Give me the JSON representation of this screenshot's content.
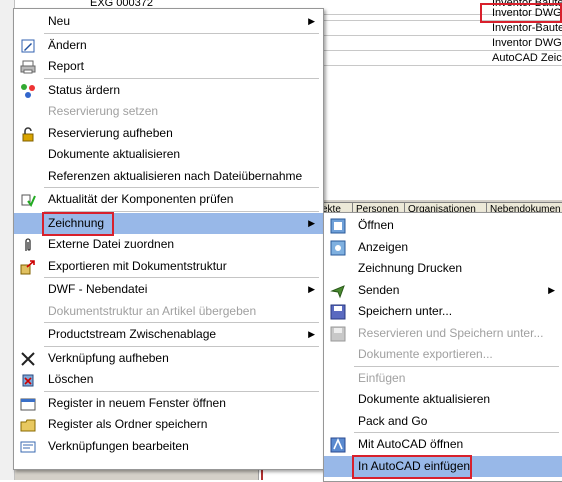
{
  "background": {
    "top_rows": [
      {
        "left": "EXG 000372",
        "right": "Inventor Bautei"
      },
      {
        "left": "",
        "right": "Inventor DWG"
      },
      {
        "left": "",
        "right": "Inventor-Bauteil"
      },
      {
        "left": "",
        "right": "Inventor DWG"
      },
      {
        "left": "",
        "right": "AutoCAD Zeich"
      }
    ],
    "tabs": [
      "ekte",
      "Personen",
      "Organisationen",
      "Nebendokumen"
    ]
  },
  "context_menu": {
    "items": [
      {
        "label": "Neu",
        "icon": "blank",
        "submenu": true
      },
      {
        "label": "Ändern",
        "icon": "edit-pencil-icon"
      },
      {
        "label": "Report",
        "icon": "printer-icon"
      },
      {
        "label": "Status ärdern",
        "icon": "status-icon"
      },
      {
        "label": "Reservierung setzen",
        "icon": "blank",
        "disabled": true
      },
      {
        "label": "Reservierung aufheben",
        "icon": "unlock-icon"
      },
      {
        "label": "Dokumente aktualisieren",
        "icon": "blank"
      },
      {
        "label": "Referenzen aktualisieren nach Dateiübernahme",
        "icon": "blank"
      },
      {
        "label": "Aktualität der Komponenten prüfen",
        "icon": "component-check-icon"
      },
      {
        "label": "Zeichnung",
        "icon": "blank",
        "submenu": true,
        "highlighted": true
      },
      {
        "label": "Externe Datei zuordnen",
        "icon": "paperclip-icon"
      },
      {
        "label": "Exportieren mit Dokumentstruktur",
        "icon": "export-icon"
      },
      {
        "label": "DWF - Nebendatei",
        "icon": "blank",
        "submenu": true
      },
      {
        "label": "Dokumentstruktur an Artikel übergeben",
        "icon": "blank",
        "disabled": true
      },
      {
        "label": "Productstream Zwischenablage",
        "icon": "blank",
        "submenu": true
      },
      {
        "label": "Verknüpfung aufheben",
        "icon": "unlink-icon"
      },
      {
        "label": "Löschen",
        "icon": "delete-icon"
      },
      {
        "label": "Register in neuem Fenster öffnen",
        "icon": "new-window-icon"
      },
      {
        "label": "Register als Ordner speichern",
        "icon": "save-folder-icon"
      },
      {
        "label": "Verknüpfungen bearbeiten",
        "icon": "edit-links-icon"
      }
    ]
  },
  "submenu": {
    "items": [
      {
        "label": "Öffnen",
        "icon": "open-icon"
      },
      {
        "label": "Anzeigen",
        "icon": "view-icon"
      },
      {
        "label": "Zeichnung Drucken",
        "icon": "blank"
      },
      {
        "label": "Senden",
        "icon": "send-icon",
        "submenu": true
      },
      {
        "label": "Speichern unter...",
        "icon": "save-icon"
      },
      {
        "label": "Reservieren und Speichern unter...",
        "icon": "reserve-save-icon",
        "disabled": true
      },
      {
        "label": "Dokumente exportieren...",
        "icon": "blank",
        "disabled": true
      },
      {
        "label": "Einfügen",
        "icon": "blank",
        "disabled": true
      },
      {
        "label": "Dokumente aktualisieren",
        "icon": "blank"
      },
      {
        "label": "Pack and Go",
        "icon": "blank"
      },
      {
        "label": "Mit AutoCAD öffnen",
        "icon": "autocad-open-icon"
      },
      {
        "label": "In AutoCAD einfügen",
        "icon": "blank",
        "highlighted": true
      }
    ]
  },
  "colors": {
    "highlight": "#98b8e8",
    "annotation_box": "#d8202c"
  }
}
